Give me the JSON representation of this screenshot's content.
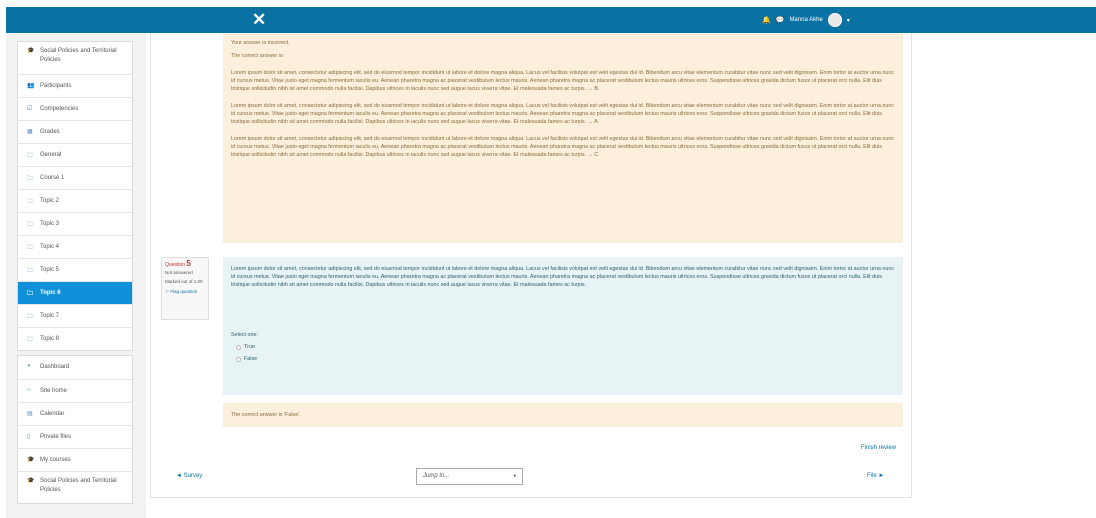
{
  "topbar": {
    "close_glyph": "✕",
    "notifications_icon": "bell-icon",
    "messages_icon": "chat-icon",
    "user_name": "Manna Akhe",
    "caret": "▾",
    "color": "#0a72a3"
  },
  "nav": {
    "group1": [
      {
        "icon": "graduation-cap-icon",
        "glyph": "🎓",
        "label": "Social Policies and Territorial Policies"
      },
      {
        "icon": "users-icon",
        "glyph": "👥",
        "label": "Participants"
      },
      {
        "icon": "checklist-icon",
        "glyph": "☑",
        "label": "Competencies"
      },
      {
        "icon": "grid-icon",
        "glyph": "▦",
        "label": "Grades"
      },
      {
        "icon": "folder-icon",
        "glyph": "🗀",
        "label": "General"
      },
      {
        "icon": "folder-icon",
        "glyph": "🗀",
        "label": "Course 1"
      },
      {
        "icon": "folder-icon",
        "glyph": "🗀",
        "label": "Topic 2"
      },
      {
        "icon": "folder-icon",
        "glyph": "🗀",
        "label": "Topic 3"
      },
      {
        "icon": "folder-icon",
        "glyph": "🗀",
        "label": "Topic 4"
      },
      {
        "icon": "folder-icon",
        "glyph": "🗀",
        "label": "Topic 5"
      },
      {
        "icon": "folder-icon",
        "glyph": "🗀",
        "label": "Topic 6",
        "active": true
      },
      {
        "icon": "folder-icon",
        "glyph": "🗀",
        "label": "Topic 7"
      },
      {
        "icon": "folder-icon",
        "glyph": "🗀",
        "label": "Topic 8"
      }
    ],
    "group2": [
      {
        "icon": "dashboard-icon",
        "glyph": "◕",
        "label": "Dashboard"
      },
      {
        "icon": "home-icon",
        "glyph": "⌂",
        "label": "Site home"
      },
      {
        "icon": "calendar-icon",
        "glyph": "▤",
        "label": "Calendar"
      },
      {
        "icon": "file-icon",
        "glyph": "▯",
        "label": "Private files"
      },
      {
        "icon": "graduation-cap-icon",
        "glyph": "🎓",
        "label": "My courses"
      },
      {
        "icon": "graduation-cap-icon",
        "glyph": "🎓",
        "label": "Social Policies and Territorial Policies"
      }
    ],
    "active_color": "#0f90d9"
  },
  "feedback": {
    "incorrect": "Your answer is incorrect.",
    "correct_label": "The correct answer is:",
    "paragraphs": [
      "Lorem ipsum dolor sit amet, consectetur adipiscing elit, sed do eiusmod tempor incididunt ut labore et dolore magna aliqua. Lacus vel facilisis volutpat est velit egestas dui id. Bibendum arcu vitae elementum curabitur vitae nunc sed velit dignissim. Enim tortor at auctor urna nunc id cursus metus. Vitae justo eget magna fermentum iaculis eu. Aenean pharetra magna ac placerat vestibulum lectus mauris. Aenean pharetra magna ac placerat vestibulum lectus mauris ultrices eros. Suspendisse ultrices gravida dictum fusce ut placerat orci nulla. Elit duis tristique sollicitudin nibh sit amet commodo nulla facilisi. Dapibus ultrices in iaculis nunc sed augue lacus viverra vitae. Et malesuada fames ac turpis. → B.",
      "Lorem ipsum dolor sit amet, consectetur adipiscing elit, sed do eiusmod tempor incididunt ut labore et dolore magna aliqua. Lacus vel facilisis volutpat est velit egestas dui id. Bibendum arcu vitae elementum curabitur vitae nunc sed velit dignissim. Enim tortor at auctor urna nunc id cursus metus. Vitae justo eget magna fermentum iaculis eu. Aenean pharetra magna ac placerat vestibulum lectus mauris. Aenean pharetra magna ac placerat vestibulum lectus mauris ultrices eros. Suspendisse ultrices gravida dictum fusce ut placerat orci nulla. Elit duis tristique sollicitudin nibh sit amet commodo nulla facilisi. Dapibus ultrices in iaculis nunc sed augue lacus viverra vitae. Et malesuada fames ac turpis. → A.",
      "Lorem ipsum dolor sit amet, consectetur adipiscing elit, sed do eiusmod tempor incididunt ut labore et dolore magna aliqua. Lacus vel facilisis volutpat est velit egestas dui id. Bibendum arcu vitae elementum curabitur vitae nunc sed velit dignissim. Enim tortor at auctor urna nunc id cursus metus. Vitae justo eget magna fermentum iaculis eu. Aenean pharetra magna ac placerat vestibulum lectus mauris. Aenean pharetra magna ac placerat vestibulum lectus mauris ultrices eros. Suspendisse ultrices gravida dictum fusce ut placerat orci nulla. Elit duis tristique sollicitudin nibh sit amet commodo nulla facilisi. Dapibus ultrices in iaculis nunc sed augue lacus viverra vitae. Et malesuada fames ac turpis. → C"
    ]
  },
  "question": {
    "label": "Question",
    "number": "5",
    "status": "Not answered",
    "marked": "Marked out of 1.00",
    "flag": "Flag question",
    "text": "Lorem ipsum dolor sit amet, consectetur adipiscing elit, sed do eiusmod tempor incididunt ut labore et dolore magna aliqua. Lacus vel facilisis volutpat est velit egestas dui id. Bibendum arcu vitae elementum curabitur vitae nunc sed velit dignissim. Enim tortor at auctor urna nunc id cursus metus. Vitae justo eget magna fermentum iaculis eu. Aenean pharetra magna ac placerat vestibulum lectus mauris. Aenean pharetra magna ac placerat vestibulum lectus mauris ultrices eros. Suspendisse ultrices gravida dictum fusce ut placerat orci nulla. Elit duis tristique sollicitudin nibh sit amet commodo nulla facilisi. Dapibus ultrices in iaculis nunc sed augue lacus viverra vitae. Et malesuada fames ac turpis.",
    "select_one": "Select one:",
    "options": [
      "True",
      "False"
    ],
    "correct_answer": "The correct answer is 'False'."
  },
  "footer": {
    "finish_review": "Finish review",
    "prev": "◄ Survey",
    "jump": "Jump to...",
    "jump_caret": "♦",
    "next": "File ►"
  }
}
